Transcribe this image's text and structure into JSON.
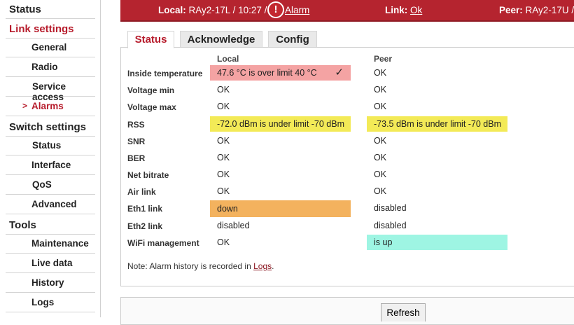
{
  "sidebar": {
    "sections": {
      "status": "Status",
      "link_settings": "Link settings",
      "switch_settings": "Switch settings",
      "tools": "Tools"
    },
    "link_items": [
      "General",
      "Radio",
      "Service access",
      "Alarms"
    ],
    "active_marker": ">",
    "switch_items": [
      "Status",
      "Interface",
      "QoS",
      "Advanced"
    ],
    "tools_items": [
      "Maintenance",
      "Live data",
      "History",
      "Logs"
    ]
  },
  "header": {
    "local_label": "Local:",
    "local_value": "RAy2-17L / 10:27 /",
    "alarm_icon": "!",
    "alarm_label": "Alarm",
    "link_label": "Link:",
    "link_value": "Ok",
    "peer_label": "Peer:",
    "peer_value": "RAy2-17U /",
    "accent_color": "#b5242f"
  },
  "tabs": [
    "Status",
    "Acknowledge",
    "Config"
  ],
  "table": {
    "col_local": "Local",
    "col_peer": "Peer",
    "rows": [
      {
        "label": "Inside temperature",
        "local": "47.6 °C is over limit 40 °C",
        "peer": "OK",
        "local_state": "red",
        "peer_state": "ok"
      },
      {
        "label": "Voltage min",
        "local": "OK",
        "peer": "OK"
      },
      {
        "label": "Voltage max",
        "local": "OK",
        "peer": "OK"
      },
      {
        "label": "RSS",
        "local": "-72.0 dBm is under limit -70 dBm",
        "peer": "-73.5 dBm is under limit -70 dBm",
        "local_state": "yellow",
        "peer_state": "yellow"
      },
      {
        "label": "SNR",
        "local": "OK",
        "peer": "OK"
      },
      {
        "label": "BER",
        "local": "OK",
        "peer": "OK"
      },
      {
        "label": "Net bitrate",
        "local": "OK",
        "peer": "OK"
      },
      {
        "label": "Air link",
        "local": "OK",
        "peer": "OK"
      },
      {
        "label": "Eth1 link",
        "local": "down",
        "peer": "disabled",
        "local_state": "orange"
      },
      {
        "label": "Eth2 link",
        "local": "disabled",
        "peer": "disabled"
      },
      {
        "label": "WiFi management",
        "local": "OK",
        "peer": "is up",
        "peer_state": "teal"
      }
    ],
    "ack_mark": "✓"
  },
  "note": {
    "prefix": "Note: Alarm history is recorded in",
    "link": "Logs",
    "suffix": "."
  },
  "refresh_label": "Refresh",
  "colors": {
    "red": "#f4a3a3",
    "yellow": "#f3ea57",
    "orange": "#f3b25e",
    "teal": "#9ef5e3"
  }
}
